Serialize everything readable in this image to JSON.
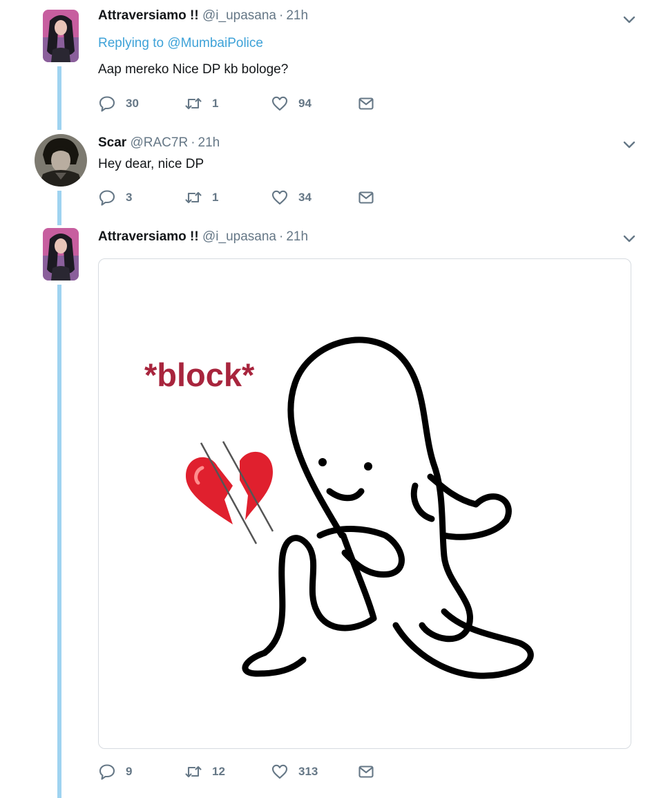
{
  "tweets": [
    {
      "display_name": "Attraversiamo !!",
      "handle": "@i_upasana",
      "time": "21h",
      "replying_label": "Replying to",
      "replying_to": "@MumbaiPolice",
      "text": "Aap mereko Nice DP kb bologe?",
      "replies": "30",
      "retweets": "1",
      "likes": "94"
    },
    {
      "display_name": "Scar",
      "handle": "@RAC7R",
      "time": "21h",
      "text": "Hey dear, nice DP",
      "replies": "3",
      "retweets": "1",
      "likes": "34"
    },
    {
      "display_name": "Attraversiamo !!",
      "handle": "@i_upasana",
      "time": "21h",
      "media_text": "*block*",
      "replies": "9",
      "retweets": "12",
      "likes": "313"
    }
  ],
  "icons": {
    "reply": "reply-icon",
    "retweet": "retweet-icon",
    "like": "heart-icon",
    "dm": "envelope-icon",
    "menu": "chevron-down-icon",
    "emoji": "broken-heart-icon"
  },
  "colors": {
    "thread_line": "#9fd3f0",
    "link": "#3ea2d8",
    "meme_text": "#a8253d",
    "broken_heart": "#e0202e",
    "muted": "#657786"
  }
}
